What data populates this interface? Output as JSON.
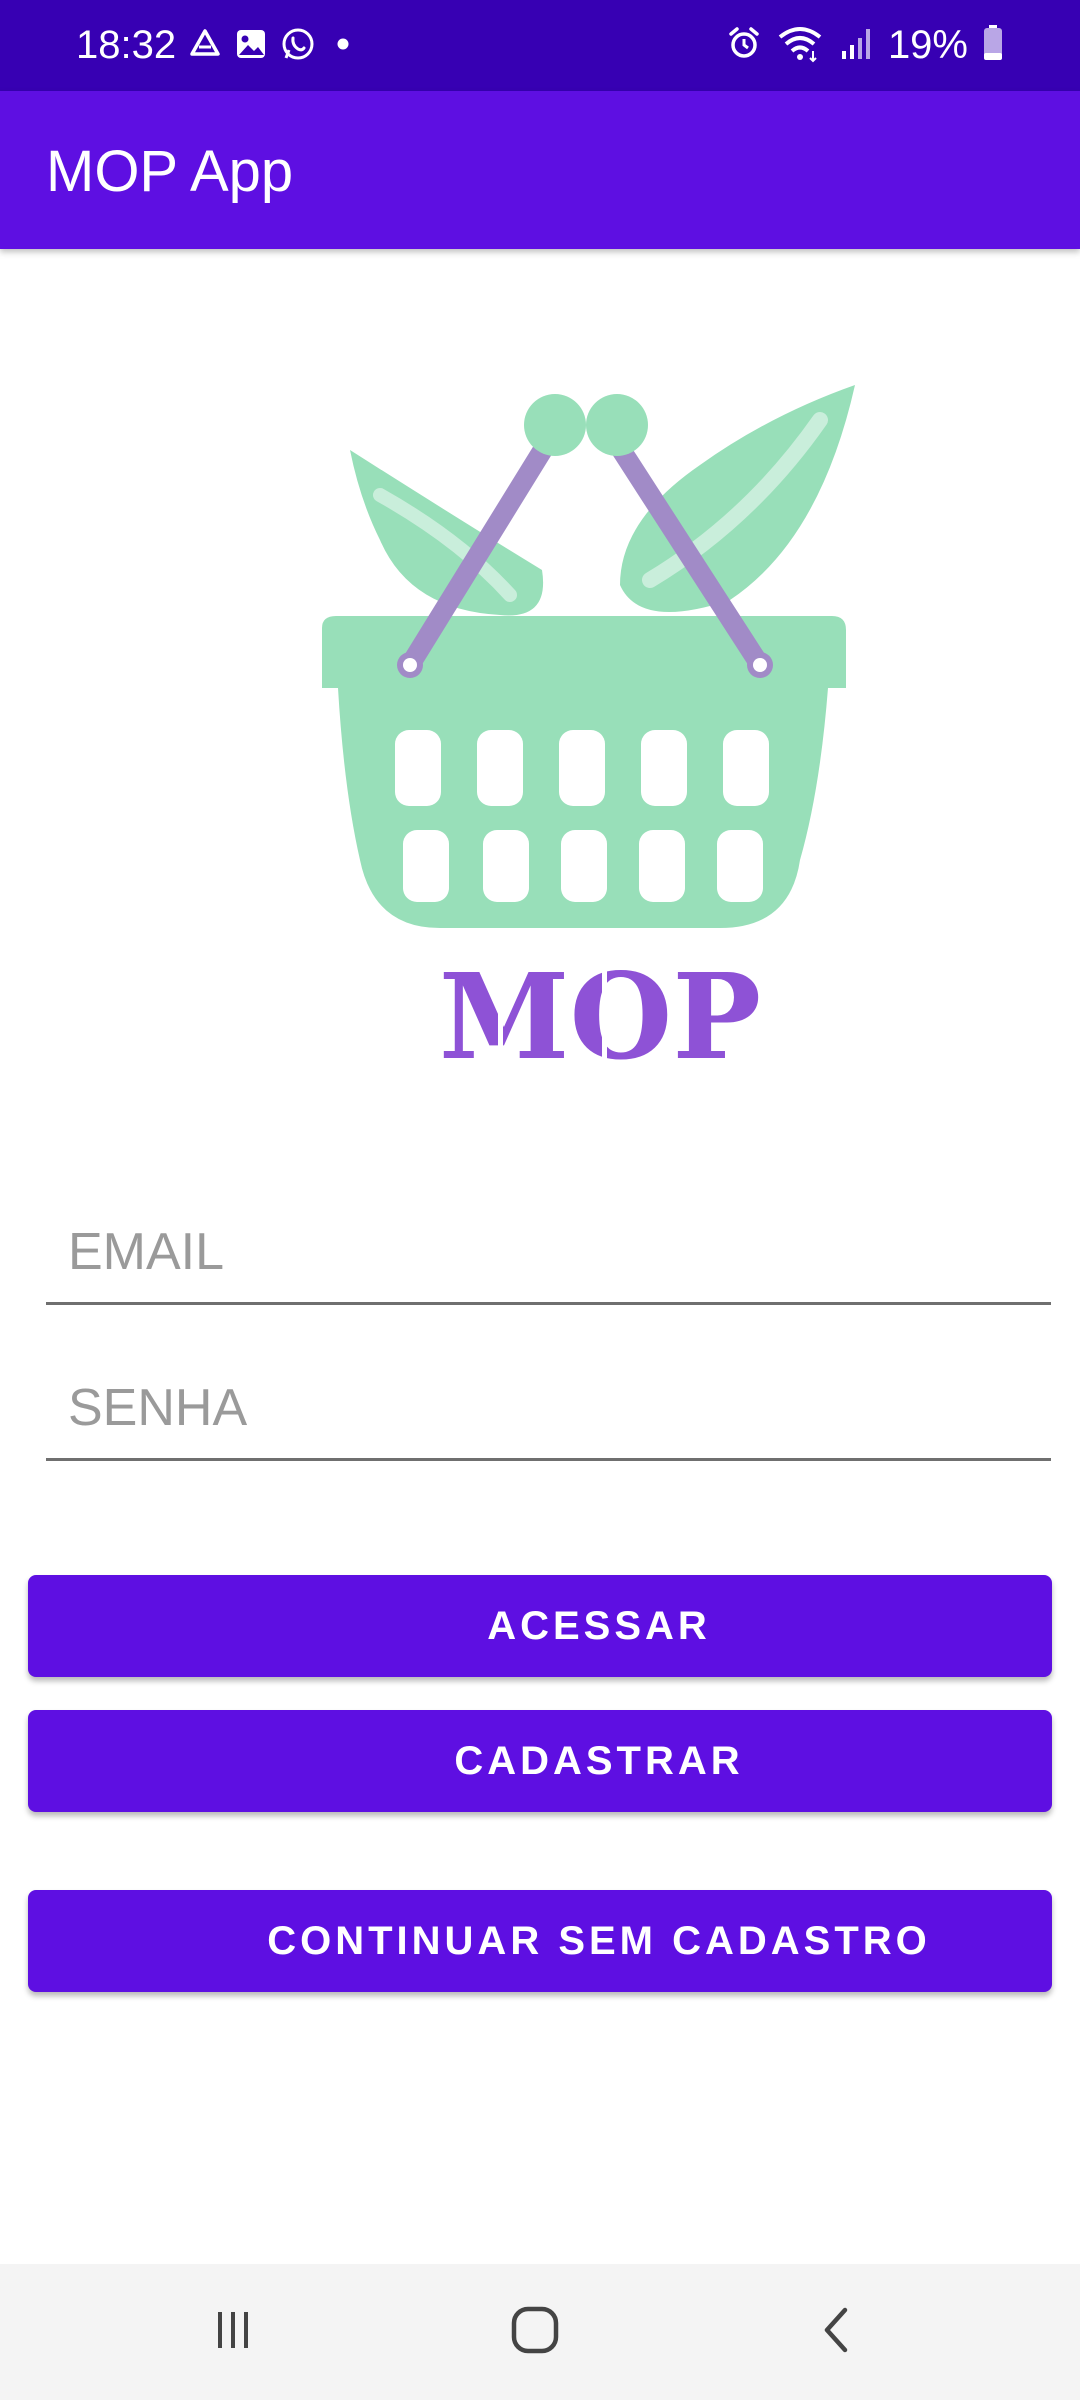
{
  "status_bar": {
    "time": "18:32",
    "battery": "19%",
    "left_icons": [
      "drive-icon",
      "gallery-icon",
      "whatsapp-icon",
      "dot-icon"
    ],
    "right_icons": [
      "alarm-icon",
      "wifi-icon",
      "signal-icon",
      "battery-icon"
    ],
    "background": "#3700B3"
  },
  "app_bar": {
    "title": "MOP App",
    "background": "#5E0FE2"
  },
  "logo": {
    "text": "MOP",
    "basket_color": "#98DFB9",
    "handle_color": "#A18BC7",
    "text_color": "#8E52D6"
  },
  "login_form": {
    "email_placeholder": "EMAIL",
    "password_placeholder": "SENHA"
  },
  "buttons": {
    "login": "ACESSAR",
    "register": "CADASTRAR",
    "guest": "CONTINUAR SEM CADASTRO",
    "color": "#5E0FE2"
  },
  "nav_bar": {
    "items": [
      "recent-apps-icon",
      "home-icon",
      "back-icon"
    ]
  }
}
